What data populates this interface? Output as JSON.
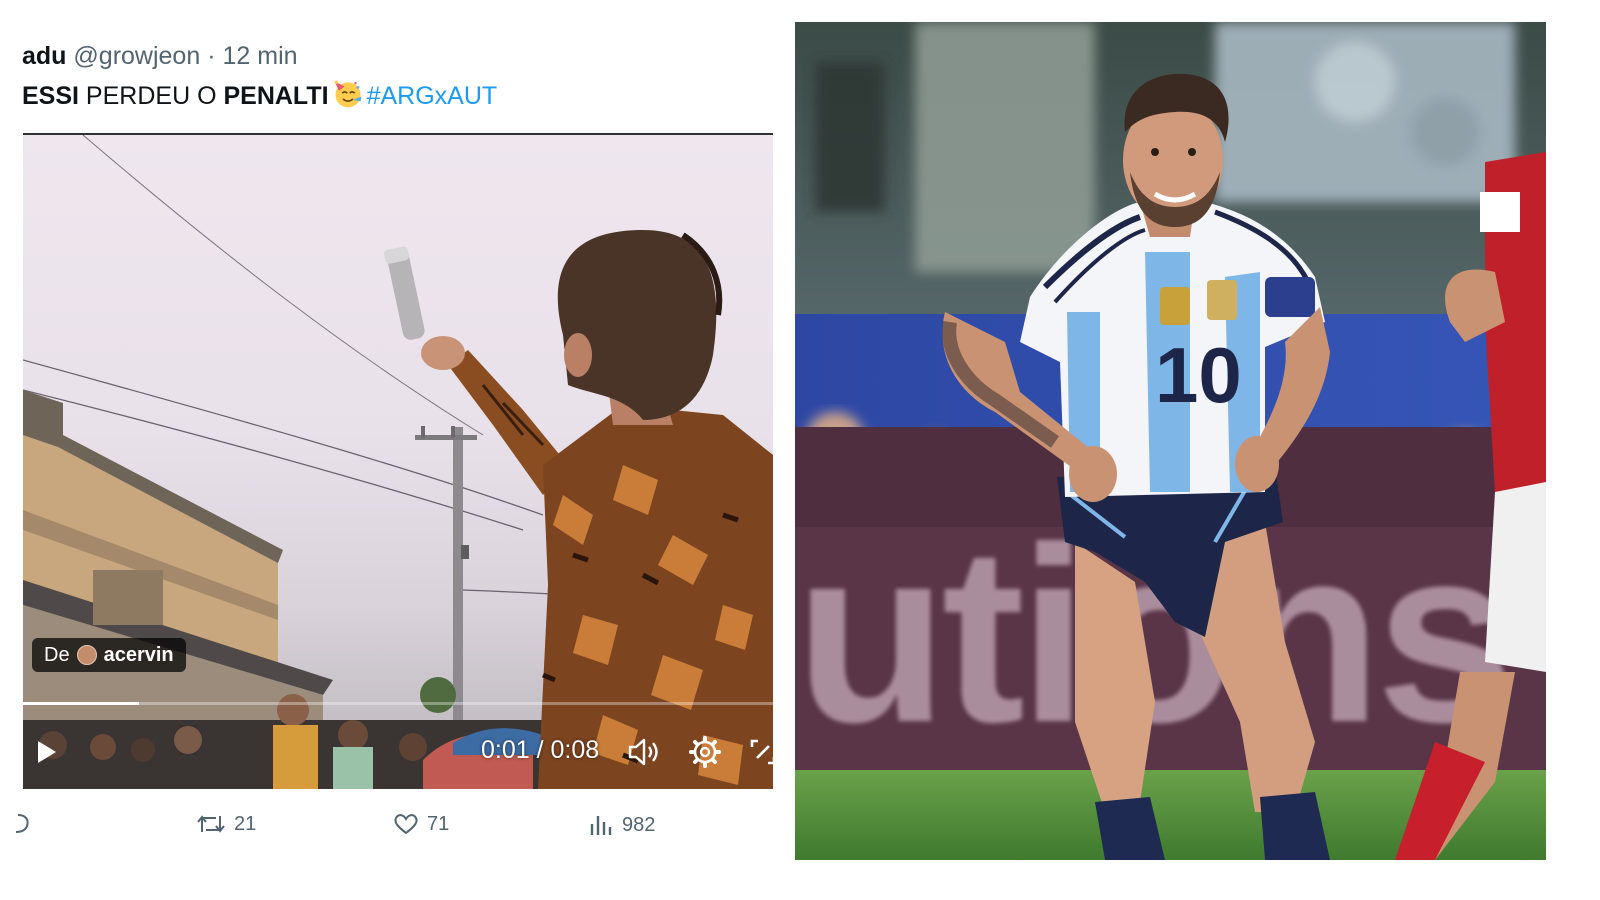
{
  "tweet": {
    "display_name": "adu",
    "handle": "@growjeon",
    "separator": "·",
    "time_ago": "12 min",
    "text_parts": {
      "bold1": "ESSI",
      "plain1": " PERDEU O ",
      "bold2": "PENALTI",
      "hashtag": "#ARGxAUT"
    },
    "emoji": "party-face",
    "video": {
      "credit_prefix": "De",
      "credit_user": "acervin",
      "elapsed": "0:01",
      "time_sep": " / ",
      "duration": "0:08",
      "progress_fraction": 0.155
    },
    "actions": {
      "retweets": "21",
      "likes": "71",
      "views": "982"
    }
  },
  "photo": {
    "board_text": "utions",
    "jersey_number": "10"
  },
  "colors": {
    "link": "#1d9bf0",
    "muted": "#536471",
    "text": "#0f1419"
  }
}
